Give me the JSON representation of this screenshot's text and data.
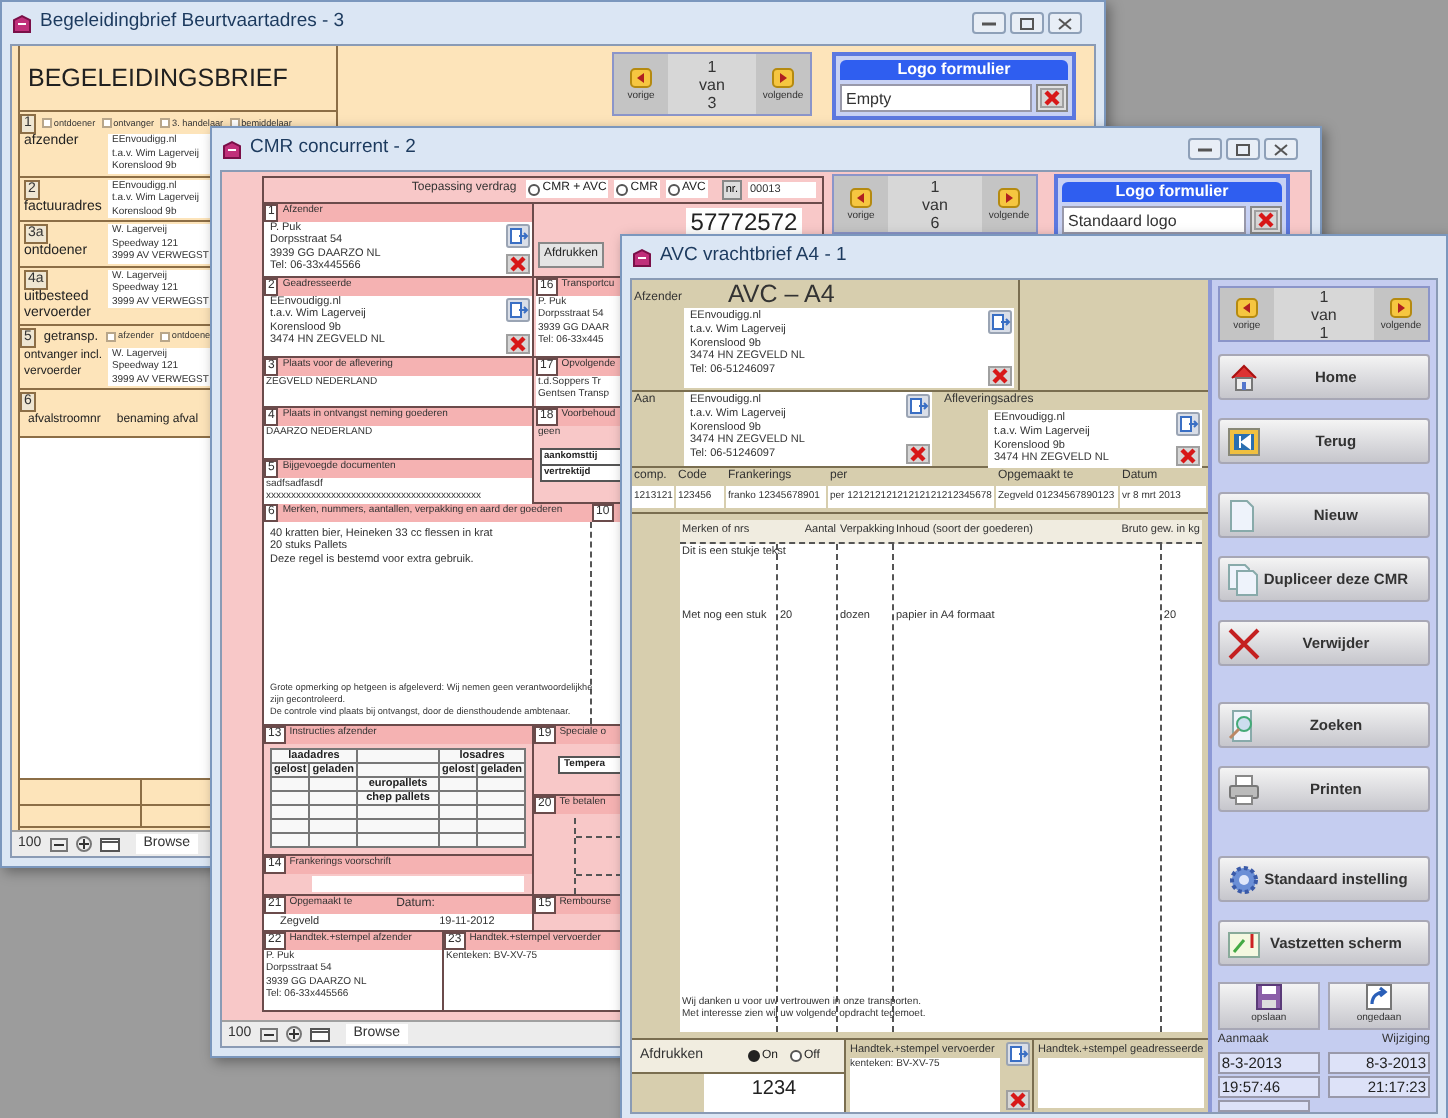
{
  "windows": [
    {
      "kind": "begeleidingsbrief",
      "title": "Begeleidingbrief Beurtvaartadres - 3",
      "heading": "BEGELEIDINGSBRIEF",
      "sections": [
        {
          "number": "1",
          "options": [
            {
              "label": "ontdoener",
              "checked": false
            },
            {
              "label": "ontvanger",
              "checked": false
            },
            {
              "label": "3. handelaar",
              "checked": false
            },
            {
              "label": "bemiddelaar",
              "checked": false
            }
          ],
          "label": "afzender",
          "lines": [
            "EEnvoudigg.nl",
            "t.a.v. Wim Lagerveij",
            "Korenslood 9b"
          ]
        },
        {
          "number": "2",
          "label": "factuuradres",
          "lines": [
            "EEnvoudigg.nl",
            "t.a.v. Wim Lagerveij",
            "Korenslood 9b"
          ]
        },
        {
          "number": "3a",
          "label": "ontdoener",
          "lines": [
            "W. Lagerveij",
            "Speedway 121",
            "3999 AV VERWEGST"
          ]
        },
        {
          "number": "4a",
          "label": "uitbesteed vervoerder",
          "lines": [
            "W. Lagerveij",
            "Speedway 121",
            "3999 AV VERWEGST"
          ]
        },
        {
          "number": "5",
          "label": "getransp.",
          "options": [
            {
              "label": "afzender",
              "checked": false
            },
            {
              "label": "ontdoene",
              "checked": false
            }
          ],
          "sublabel": "ontvanger incl. vervoerder",
          "lines": [
            "W. Lagerveij",
            "Speedway 121",
            "3999 AV VERWEGST"
          ]
        },
        {
          "number": "6",
          "columns": [
            "afvalstroomnr",
            "benaming afval"
          ]
        }
      ],
      "nav": {
        "previous": "vorige",
        "position": "1 van 3",
        "next": "volgende"
      },
      "logo": {
        "title": "Logo formulier",
        "value": "Empty"
      },
      "status_bar": {
        "zoom": "100",
        "mode": "Browse"
      }
    },
    {
      "kind": "cmr",
      "title": "CMR concurrent - 2",
      "treaty": {
        "label": "Toepassing verdrag",
        "options": [
          {
            "label": "CMR + AVC",
            "selected": false
          },
          {
            "label": "CMR",
            "selected": false
          },
          {
            "label": "AVC",
            "selected": false
          }
        ],
        "number_label": "nr.",
        "number": "00013"
      },
      "document_number": "57772572",
      "print_button": "Afdrukken",
      "left_sections": [
        {
          "kind": "address",
          "number": "1",
          "title": "Afzender",
          "lines": [
            "P. Puk",
            "Dorpsstraat 54",
            "3939 GG  DAARZO     NL",
            "Tel: 06-33x445566"
          ]
        },
        {
          "kind": "address",
          "number": "2",
          "title": "Geadresseerde",
          "lines": [
            "EEnvoudigg.nl",
            "t.a.v. Wim Lagerveij",
            "Korenslood 9b",
            "3474 HN  ZEGVELD     NL"
          ]
        },
        {
          "kind": "text",
          "number": "3",
          "title": "Plaats voor de aflevering",
          "lines": [
            "ZEGVELD   NEDERLAND"
          ]
        },
        {
          "kind": "text",
          "number": "4",
          "title": "Plaats in ontvangst neming goederen",
          "lines": [
            "DAARZO   NEDERLAND"
          ]
        },
        {
          "kind": "text",
          "number": "5",
          "title": "Bijgevoegde documenten",
          "lines": [
            "sadfsadfasdf",
            "xxxxxxxxxxxxxxxxxxxxxxxxxxxxxxxxxxxxxxxxxxx"
          ]
        }
      ],
      "right_sections": [
        {
          "kind": "text",
          "number": "16",
          "title": "Transportcu",
          "lines": [
            "P. Puk",
            "Dorpsstraat 54",
            "3939 GG  DAAR",
            "Tel: 06-33x445"
          ]
        },
        {
          "kind": "text",
          "number": "17",
          "title": "Opvolgende",
          "lines": [
            "t.d.Soppers Tr",
            "Gentsen Transp"
          ]
        },
        {
          "kind": "times",
          "number": "18",
          "title": "Voorbehoud",
          "lines": [
            "geen"
          ],
          "cells": [
            "aankomsttij",
            "vertrektijd"
          ]
        }
      ],
      "goods": {
        "number": "6",
        "title": "Merken, nummers, aantallen, verpakking en aard der goederen",
        "next_number": "10",
        "lines": [
          "40 kratten bier, Heineken 33 cc flessen in krat",
          "20 stuks Pallets",
          "Deze regel is bestemd voor extra gebruik."
        ],
        "remarks": [
          "Grote opmerking op hetgeen is afgeleverd: Wij nemen geen verantwoordelijkhe",
          "zijn gecontroleerd.",
          "De controle vind plaats bij ontvangst, door de diensthoudende ambtenaar."
        ]
      },
      "lower_left": [
        {
          "kind": "pallets",
          "number": "13",
          "title": "Instructies afzender",
          "groups": [
            "laadadres",
            "losadres"
          ],
          "columns": [
            "gelost",
            "geladen",
            "gelost",
            "geladen"
          ],
          "rows": [
            "europallets",
            "chep pallets"
          ]
        },
        {
          "kind": "field",
          "number": "14",
          "title": "Frankerings voorschrift"
        },
        {
          "kind": "date",
          "number": "21",
          "title": "Opgemaakt te",
          "date_label": "Datum:",
          "lines": [
            "Zegveld",
            "19-11-2012"
          ]
        }
      ],
      "lower_right": [
        {
          "kind": "boxed",
          "number": "19",
          "title": "Speciale o",
          "lines": [
            "Tempera"
          ]
        },
        {
          "kind": "dashed",
          "number": "20",
          "title": "Te betalen"
        },
        {
          "kind": "plain",
          "number": "15",
          "title": "Rembourse"
        }
      ],
      "signatures": [
        {
          "kind": "text",
          "number": "22",
          "title": "Handtek.+stempel afzender",
          "lines": [
            "P. Puk",
            "Dorpsstraat 54",
            "3939 GG  DAARZO     NL",
            "Tel: 06-33x445566"
          ]
        },
        {
          "kind": "text",
          "number": "23",
          "title": "Handtek.+stempel vervoerder",
          "lines": [
            "Kenteken:  BV-XV-75"
          ]
        }
      ],
      "nav": {
        "previous": "vorige",
        "position": "1 van 6",
        "next": "volgende"
      },
      "logo": {
        "title": "Logo formulier",
        "value": "Standaard logo"
      },
      "status_bar": {
        "zoom": "100",
        "mode": "Browse"
      }
    },
    {
      "kind": "avc",
      "title": "AVC vrachtbrief A4 - 1",
      "heading": "AVC – A4",
      "sender": {
        "label": "Afzender",
        "lines": [
          "EEnvoudigg.nl",
          "t.a.v. Wim Lagerveij",
          "Korenslood 9b",
          "3474 HN  ZEGVELD     NL",
          "Tel: 06-51246097"
        ]
      },
      "recipient": {
        "label": "Aan",
        "lines": [
          "EEnvoudigg.nl",
          "t.a.v. Wim Lagerveij",
          "Korenslood 9b",
          "3474 HN  ZEGVELD     NL",
          "Tel: 06-51246097"
        ]
      },
      "delivery": {
        "label": "Afleveringsadres",
        "lines": [
          "EEnvoudigg.nl",
          "t.a.v. Wim Lagerveij",
          "Korenslood 9b",
          "3474 HN  ZEGVELD     NL"
        ]
      },
      "fields": [
        {
          "label": "comp.",
          "value": "1213121"
        },
        {
          "label": "Code",
          "value": "123456"
        },
        {
          "label": "Frankerings",
          "value": "franko 12345678901"
        },
        {
          "label": "per",
          "value": "per 12121212121212121212345678"
        },
        {
          "label": "Opgemaakt te",
          "value": "Zegveld 01234567890123"
        },
        {
          "label": "Datum",
          "value": "vr 8 mrt 2013"
        }
      ],
      "goods": {
        "columns": [
          "Merken of nrs",
          "Aantal",
          "Verpakking",
          "Inhoud (soort der goederen)",
          "Bruto gew. in kg"
        ],
        "rows": [
          [
            "Dit is een stukje tekst"
          ],
          [
            "Met nog een stuk",
            "20",
            "dozen",
            "papier in A4 formaat",
            "20"
          ]
        ],
        "footer": [
          "Wij danken u voor uw vertrouwen in onze transporten.",
          "Met interesse zien wij uw volgende opdracht tegemoet."
        ]
      },
      "print": {
        "label": "Afdrukken",
        "options": [
          {
            "label": "On",
            "selected": true
          },
          {
            "label": "Off",
            "selected": false
          }
        ],
        "value": "1234"
      },
      "carrier_signature": {
        "title": "Handtek.+stempel vervoerder",
        "lines": [
          "kenteken:  BV-XV-75"
        ]
      },
      "consignee_signature": {
        "title": "Handtek.+stempel geadresseerde"
      },
      "nav": {
        "previous": "vorige",
        "position": "1 van 1",
        "next": "volgende"
      },
      "button_groups": [
        [
          {
            "label": "Home"
          },
          {
            "label": "Terug"
          }
        ],
        [
          {
            "label": "Nieuw"
          },
          {
            "label": "Dupliceer deze CMR"
          },
          {
            "label": "Verwijder"
          }
        ],
        [
          {
            "label": "Zoeken"
          },
          {
            "label": "Printen"
          }
        ],
        [
          {
            "label": "Standaard instelling"
          },
          {
            "label": "Vastzetten scherm"
          }
        ]
      ],
      "small_buttons": [
        {
          "label": "opslaan"
        },
        {
          "label": "ongedaan"
        }
      ],
      "timestamps": {
        "created_label": "Aanmaak",
        "modified_label": "Wijziging",
        "created": [
          "8-3-2013",
          "19:57:46"
        ],
        "modified": [
          "8-3-2013",
          "21:17:23"
        ]
      }
    }
  ]
}
